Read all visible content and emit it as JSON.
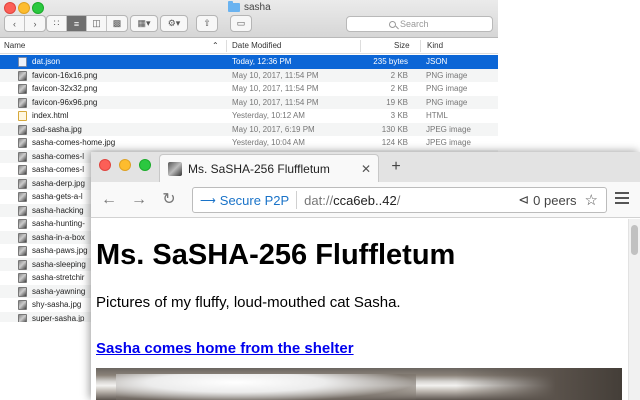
{
  "finder": {
    "title": "sasha",
    "search_placeholder": "Search",
    "columns": {
      "name": "Name",
      "date": "Date Modified",
      "size": "Size",
      "kind": "Kind"
    },
    "files": [
      {
        "name": "dat.json",
        "date": "Today, 12:36 PM",
        "size": "235 bytes",
        "kind": "JSON",
        "icon": "json"
      },
      {
        "name": "favicon-16x16.png",
        "date": "May 10, 2017, 11:54 PM",
        "size": "2 KB",
        "kind": "PNG image",
        "icon": "img"
      },
      {
        "name": "favicon-32x32.png",
        "date": "May 10, 2017, 11:54 PM",
        "size": "2 KB",
        "kind": "PNG image",
        "icon": "img"
      },
      {
        "name": "favicon-96x96.png",
        "date": "May 10, 2017, 11:54 PM",
        "size": "19 KB",
        "kind": "PNG image",
        "icon": "img"
      },
      {
        "name": "index.html",
        "date": "Yesterday, 10:12 AM",
        "size": "3 KB",
        "kind": "HTML",
        "icon": "html"
      },
      {
        "name": "sad-sasha.jpg",
        "date": "May 10, 2017, 6:19 PM",
        "size": "130 KB",
        "kind": "JPEG image",
        "icon": "img"
      },
      {
        "name": "sasha-comes-home.jpg",
        "date": "Yesterday, 10:04 AM",
        "size": "124 KB",
        "kind": "JPEG image",
        "icon": "img"
      },
      {
        "name": "sasha-comes-l",
        "icon": "img"
      },
      {
        "name": "sasha-comes-l",
        "icon": "img"
      },
      {
        "name": "sasha-derp.jpg",
        "icon": "img"
      },
      {
        "name": "sasha-gets-a-l",
        "icon": "img"
      },
      {
        "name": "sasha-hacking",
        "icon": "img"
      },
      {
        "name": "sasha-hunting-",
        "icon": "img"
      },
      {
        "name": "sasha-in-a-box",
        "icon": "img"
      },
      {
        "name": "sasha-paws.jpg",
        "icon": "img"
      },
      {
        "name": "sasha-sleeping",
        "icon": "img"
      },
      {
        "name": "sasha-stretchir",
        "icon": "img"
      },
      {
        "name": "sasha-yawning",
        "icon": "img"
      },
      {
        "name": "shy-sasha.jpg",
        "icon": "img"
      },
      {
        "name": "super-sasha.jp",
        "icon": "img"
      }
    ]
  },
  "browser": {
    "tab_title": "Ms. SaSHA-256 Fluffletum",
    "secure_label": "Secure P2P",
    "url_scheme": "dat://",
    "url_host": "cca6eb..42",
    "url_tail": "/",
    "peers": "0 peers",
    "page": {
      "heading": "Ms. SaSHA-256 Fluffletum",
      "intro": "Pictures of my fluffy, loud-mouthed cat Sasha.",
      "link": "Sasha comes home from the shelter"
    }
  }
}
